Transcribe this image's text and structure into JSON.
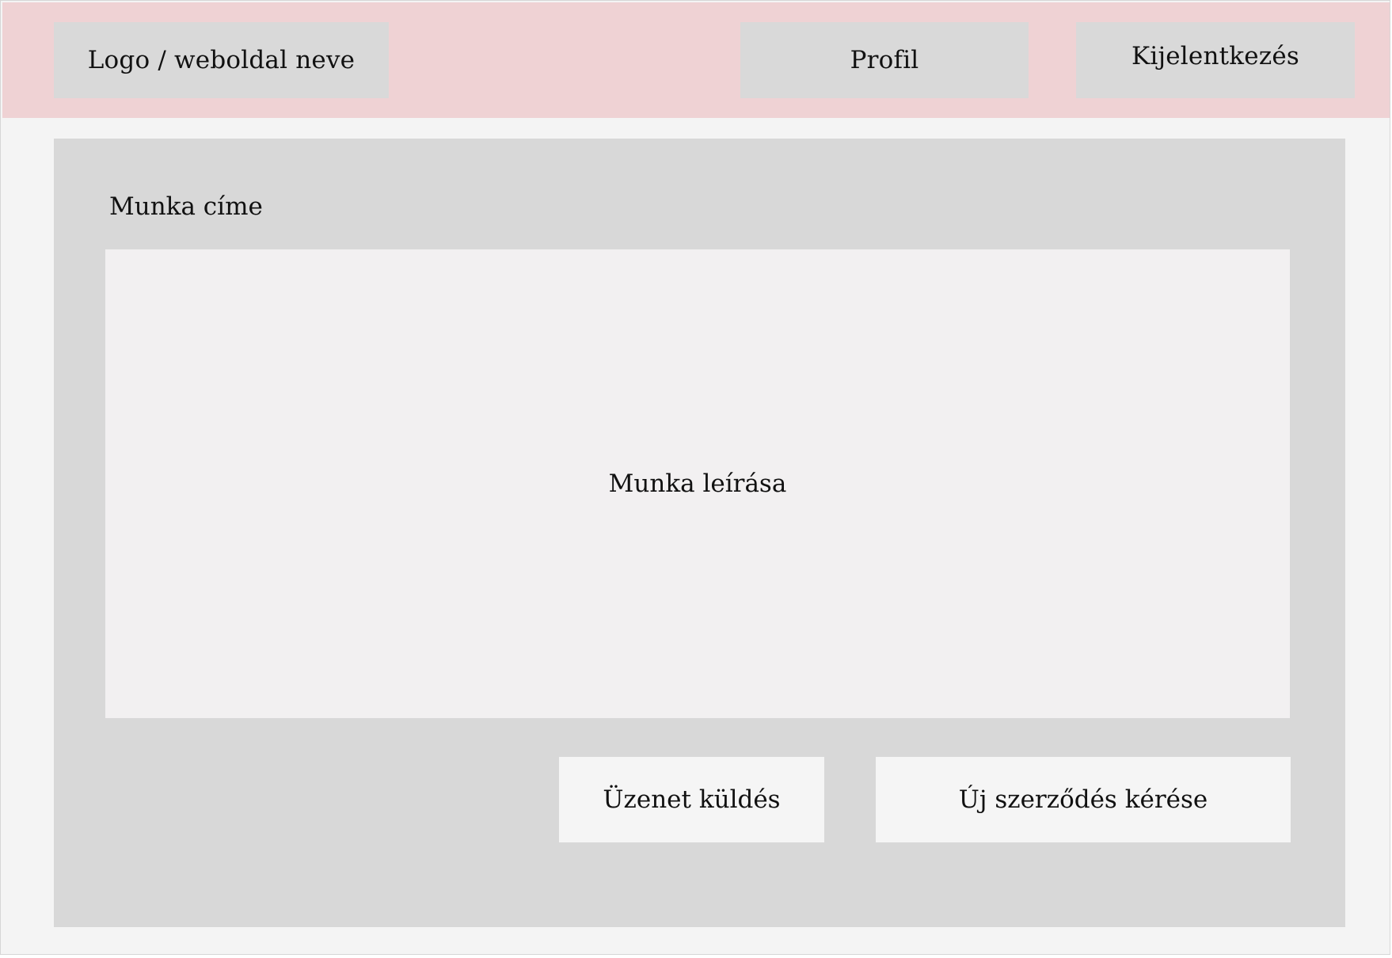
{
  "header": {
    "logo_label": "Logo / weboldal neve",
    "profile_label": "Profil",
    "logout_label": "Kijelentkezés"
  },
  "job": {
    "title": "Munka címe",
    "description": "Munka leírása"
  },
  "actions": {
    "send_message_label": "Üzenet küldés",
    "new_contract_label": "Új szerződés kérése"
  },
  "colors": {
    "header_bg": "#efd2d4",
    "panel_bg": "#d8d8d8",
    "description_bg": "#f2f0f1",
    "button_bg": "#f5f5f5"
  }
}
